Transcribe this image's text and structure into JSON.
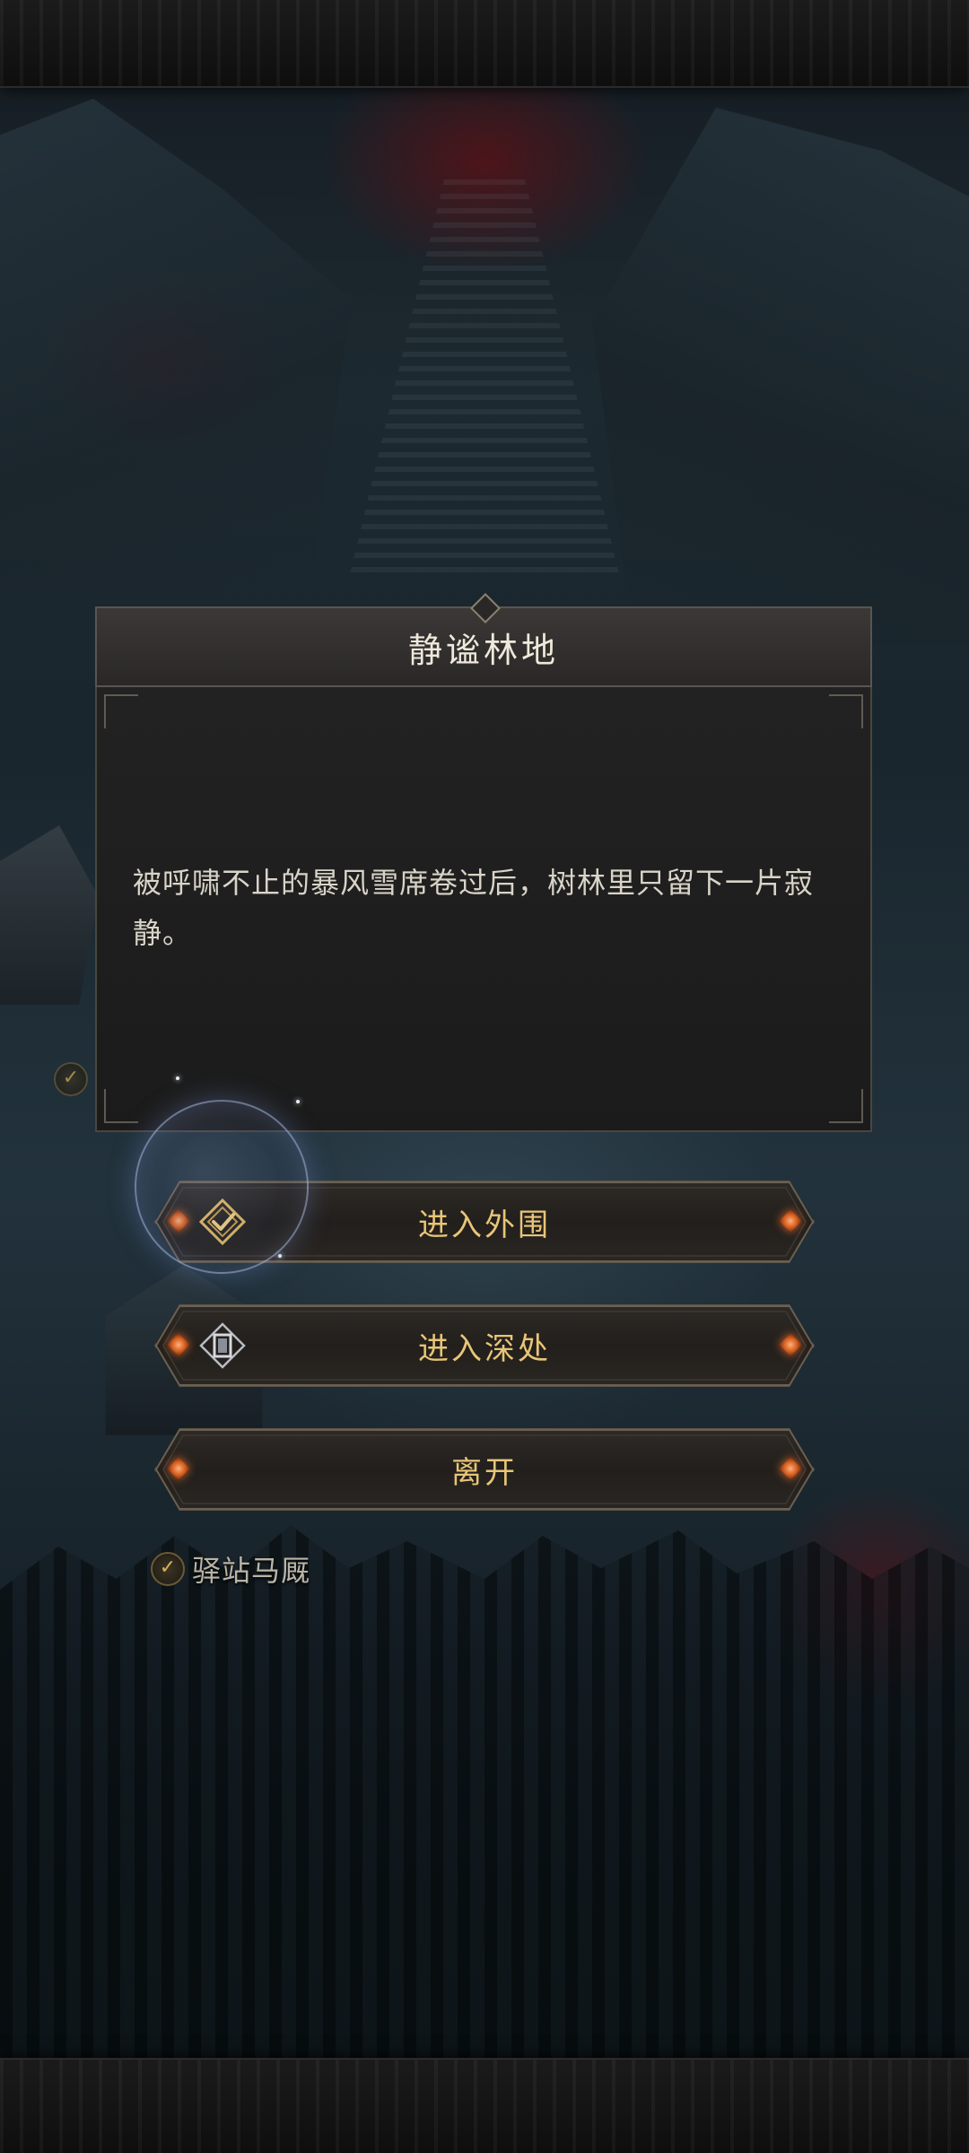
{
  "dialog": {
    "title": "静谧林地",
    "text": "被呼啸不止的暴风雪席卷过后，树林里只留下一片寂静。"
  },
  "options": [
    {
      "label": "进入外围",
      "icon": "check-emblem-icon"
    },
    {
      "label": "进入深处",
      "icon": "door-emblem-icon"
    },
    {
      "label": "离开",
      "icon": ""
    }
  ],
  "map": {
    "location_label": "驿站马厩",
    "location_checked": true
  },
  "colors": {
    "accent_gold": "#e8c577",
    "gem_orange": "#d25a1c",
    "panel_dark": "#1f1f1f"
  }
}
